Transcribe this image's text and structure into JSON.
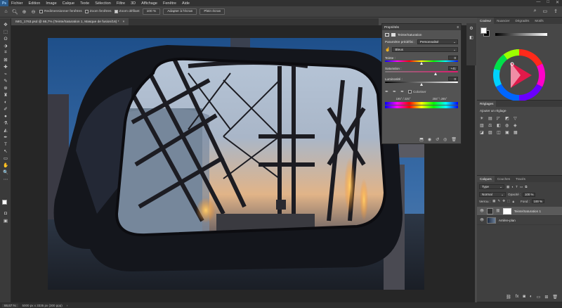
{
  "menu": [
    "Fichier",
    "Edition",
    "Image",
    "Calque",
    "Texte",
    "Sélection",
    "Filtre",
    "3D",
    "Affichage",
    "Fenêtre",
    "Aide"
  ],
  "logo": "Ps",
  "window_controls": [
    "—",
    "□",
    "✕"
  ],
  "options": {
    "resize_windows": "Redimensionner fenêtres",
    "zoom_all": "Zoom fenêtres",
    "scrubby_zoom": "Zoom défilant",
    "zoom_value": "100 %",
    "fit_screen": "Adapter à l'écran",
    "fill_screen": "Plein écran"
  },
  "document_tab": {
    "label": "IMG_1763.psd @ 66,7% (Teinte/Saturation 1, Masque de fusion/16) *",
    "close": "×"
  },
  "tools": [
    "✥",
    "⬚",
    "ʘ",
    "⬗",
    "⌗",
    "⊠",
    "✚",
    "⌁",
    "✎",
    "⊕",
    "♜",
    "◐",
    "✐",
    "●",
    "⚗",
    "◭",
    "✒",
    "T",
    "↖",
    "▭",
    "✋",
    "🔍",
    "⋯"
  ],
  "status": {
    "zoom": "66,67 %",
    "size": "5000 px x 3335 px (300 ppp)",
    "arrow": "›"
  },
  "properties": {
    "title": "Propriétés",
    "adj_name": "Teinte/Saturation",
    "preset_label": "Paramètre prédéfini :",
    "preset_value": "Personnalisé",
    "channel": "Bleus",
    "hue_label": "Teinte :",
    "hue_value": "0",
    "hue_pos": 0.5,
    "sat_label": "Saturation :",
    "sat_value": "+41",
    "sat_pos": 0.7,
    "light_label": "Luminosité :",
    "light_value": "0",
    "light_pos": 0.5,
    "colorize": "Coloriser",
    "range_left": "195° / 225°",
    "range_right": "255° \\ 285°"
  },
  "color_panel": {
    "tabs": [
      "Couleur",
      "Nuancier",
      "Dégradés",
      "Motifs"
    ],
    "fg_color": "#ffffff",
    "bg_color": "#000000"
  },
  "adjustments_panel": {
    "title": "Réglages",
    "subtitle": "Ajouter un réglage"
  },
  "layers_panel": {
    "tabs": [
      "Calques",
      "Couches",
      "Tracés"
    ],
    "filter": "Type",
    "blend_mode": "Normal",
    "opacity_label": "Opacité :",
    "opacity_value": "100 %",
    "lock_label": "Verrou :",
    "fill_label": "Fond :",
    "fill_value": "100 %",
    "layers": [
      {
        "name": "Teinte/Saturation 1",
        "type": "adjustment"
      },
      {
        "name": "Arrière-plan",
        "type": "image"
      }
    ]
  }
}
